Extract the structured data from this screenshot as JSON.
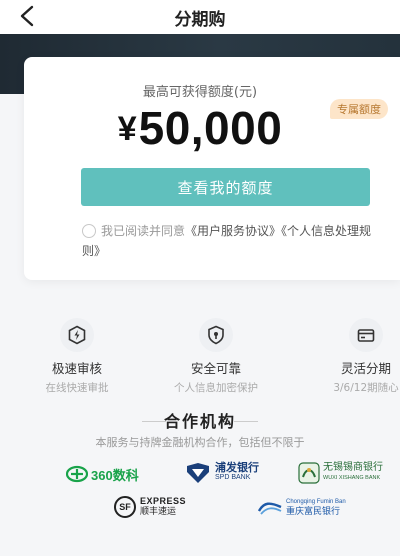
{
  "header": {
    "title": "分期购"
  },
  "card": {
    "quota_label": "最高可获得额度(元)",
    "badge": "专属额度",
    "currency": "¥",
    "amount": "50,000",
    "cta_label": "查看我的额度",
    "agreement": {
      "prefix": "我已阅读并同意",
      "link1": "《用户服务协议》",
      "link2": "《个人信息处理规则》"
    }
  },
  "features": [
    {
      "icon": "lightning-icon",
      "title": "极速审核",
      "subtitle": "在线快速审批"
    },
    {
      "icon": "lock-shield-icon",
      "title": "安全可靠",
      "subtitle": "个人信息加密保护"
    },
    {
      "icon": "card-icon",
      "title": "灵活分期",
      "subtitle": "3/6/12期随心"
    }
  ],
  "partners": {
    "title": "合作机构",
    "subtitle": "本服务与持牌金融机构合作，包括但不限于",
    "logos": [
      {
        "name": "360数科",
        "color": "#19a34a"
      },
      {
        "name": "浦发银行",
        "sub": "SPD BANK",
        "color": "#1a3f7a"
      },
      {
        "name": "无锡锡商银行",
        "sub": "WUXI XISHANG BANK",
        "color": "#2a6f3a"
      },
      {
        "name": "顺丰速运",
        "sub": "EXPRESS",
        "badge": "SF",
        "color": "#222222"
      },
      {
        "name": "重庆富民银行",
        "sub": "Chongqing Fumin Ban",
        "color": "#1e5aa8"
      }
    ]
  },
  "colors": {
    "accent": "#60c0bd",
    "badge_bg": "#fde5c9",
    "badge_text": "#b6772f"
  }
}
